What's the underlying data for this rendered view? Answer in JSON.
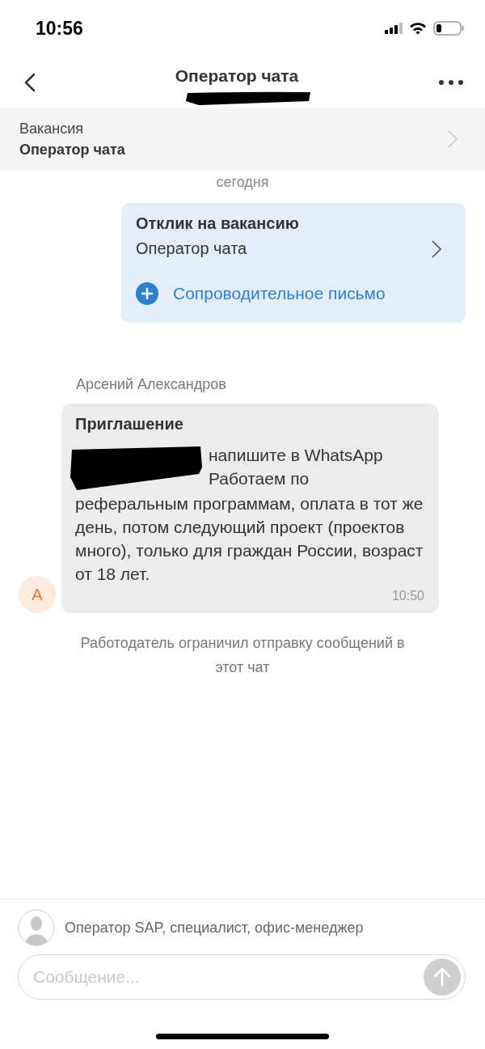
{
  "status_bar": {
    "time": "10:56"
  },
  "header": {
    "title": "Оператор чата"
  },
  "vacancy": {
    "label": "Вакансия",
    "title": "Оператор чата"
  },
  "date_label": "сегодня",
  "response_card": {
    "title": "Отклик на вакансию",
    "vacancy": "Оператор чата",
    "action": "Сопроводительное письмо"
  },
  "incoming": {
    "sender": "Арсений Александров",
    "avatar_letter": "А",
    "title": "Приглашение",
    "text_beside_redaction": "напишите в WhatsApp Работаем по",
    "text": "реферальным программам, оплата в тот же день, потом следующий проект (проектов много), только для граждан России, возраст от 18 лет.",
    "time": "10:50"
  },
  "notice": "Работодатель ограничил отправку сообщений в этот чат",
  "composer": {
    "suggestion": "Оператор SAP, специалист, офис-менеджер",
    "placeholder": "Сообщение..."
  }
}
